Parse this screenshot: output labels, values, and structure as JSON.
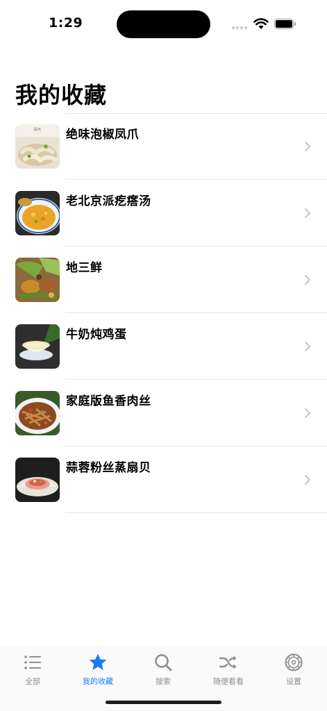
{
  "status_bar": {
    "time": "1:29"
  },
  "page": {
    "title": "我的收藏"
  },
  "favorites": [
    {
      "title": "绝味泡椒凤爪",
      "image": "pickled-pepper-chicken-feet"
    },
    {
      "title": "老北京派疙瘩汤",
      "image": "old-beijing-dough-drop-soup"
    },
    {
      "title": "地三鲜",
      "image": "di-san-xian"
    },
    {
      "title": "牛奶炖鸡蛋",
      "image": "milk-steamed-egg"
    },
    {
      "title": "家庭版鱼香肉丝",
      "image": "fish-flavored-shredded-pork"
    },
    {
      "title": "蒜蓉粉丝蒸扇贝",
      "image": "garlic-vermicelli-scallop"
    }
  ],
  "tabs": [
    {
      "label": "全部",
      "icon": "list-icon",
      "active": false
    },
    {
      "label": "我的收藏",
      "icon": "star-icon",
      "active": true
    },
    {
      "label": "搜索",
      "icon": "search-icon",
      "active": false
    },
    {
      "label": "随便看看",
      "icon": "shuffle-icon",
      "active": false
    },
    {
      "label": "设置",
      "icon": "gear-icon",
      "active": false
    }
  ],
  "colors": {
    "accent": "#1a7cf5",
    "inactive": "#8e8e93",
    "separator": "#e5e5ea"
  }
}
